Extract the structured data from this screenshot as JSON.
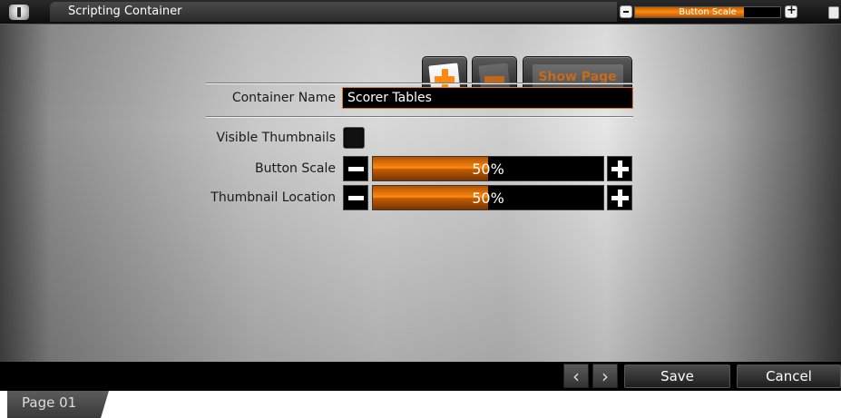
{
  "window": {
    "title": "Scripting Container",
    "header_scale": {
      "label": "Button Scale",
      "fill_fraction": 0.75
    }
  },
  "toolbar": {
    "add_icon": "add-page-icon",
    "remove_icon": "remove-page-icon",
    "show_page_label": "Show Page"
  },
  "form": {
    "container_name_label": "Container Name",
    "container_name_value": "Scorer Tables",
    "visible_thumbnails_label": "Visible Thumbnails",
    "visible_thumbnails_checked": false,
    "button_scale_label": "Button Scale",
    "button_scale_value": "50%",
    "button_scale_fraction": 0.5,
    "thumbnail_location_label": "Thumbnail Location",
    "thumbnail_location_value": "50%",
    "thumbnail_location_fraction": 0.5
  },
  "footer": {
    "prev_glyph": "‹",
    "next_glyph": "›",
    "save_label": "Save",
    "cancel_label": "Cancel"
  },
  "tabs": [
    {
      "label": "Page 01"
    }
  ],
  "colors": {
    "accent_orange": "#ff8a10",
    "input_background": "#000000"
  }
}
